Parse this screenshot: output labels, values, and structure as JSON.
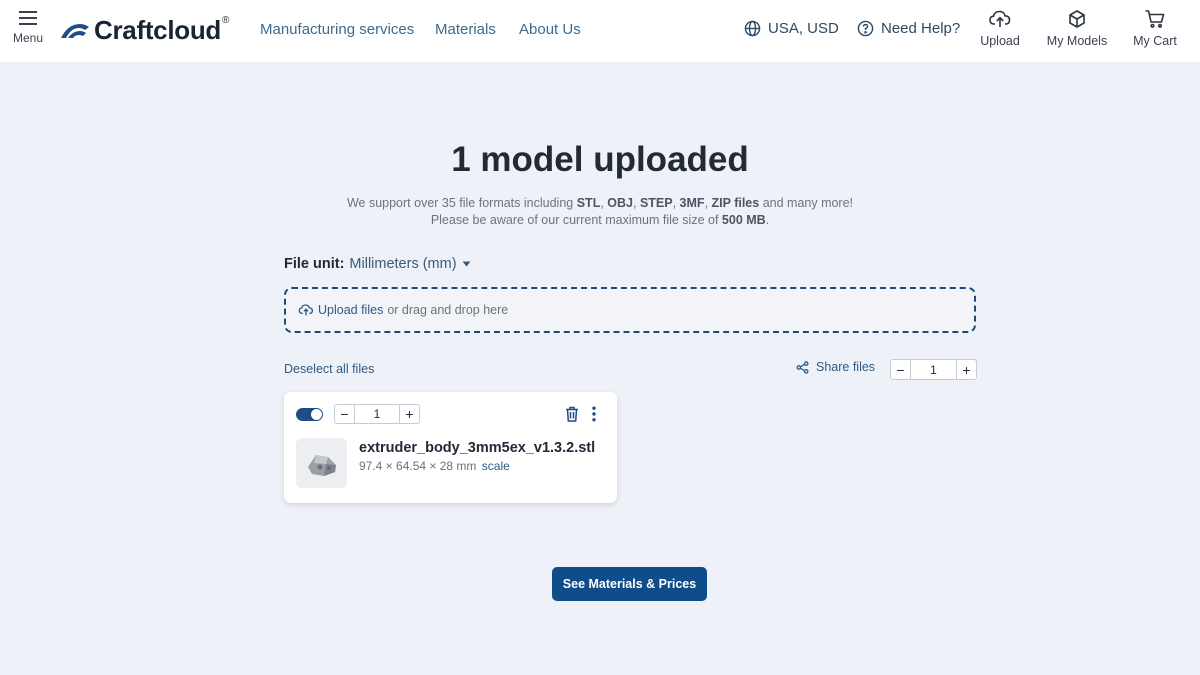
{
  "header": {
    "menu_label": "Menu",
    "brand": "Craftcloud",
    "brand_mark": "®",
    "nav": {
      "manufacturing": "Manufacturing services",
      "materials": "Materials",
      "about": "About Us"
    },
    "region": "USA, USD",
    "help": "Need Help?",
    "upload": "Upload",
    "my_models": "My Models",
    "my_cart": "My Cart"
  },
  "main": {
    "title": "1 model uploaded",
    "support_line1": {
      "pre": "We support over 35 file formats including",
      "f1": "STL",
      "f2": "OBJ",
      "f3": "STEP",
      "f4": "3MF",
      "f5": "ZIP files",
      "post": "and many more!"
    },
    "support_line2": {
      "pre": "Please be aware of our current maximum file size of",
      "size": "500 MB",
      "post": "."
    },
    "file_unit_label": "File unit:",
    "file_unit_value": "Millimeters (mm)",
    "dropzone": {
      "link": "Upload files",
      "text": "or drag and drop here"
    },
    "deselect_all": "Deselect all files",
    "share_files": "Share files",
    "global_quantity": "1",
    "cta": "See Materials & Prices"
  },
  "models": [
    {
      "selected": true,
      "quantity": "1",
      "filename": "extruder_body_3mm5ex_v1.3.2.stl",
      "dimensions": "97.4 × 64.54 × 28 mm",
      "scale_label": "scale"
    }
  ],
  "colors": {
    "accent": "#0f4c8a",
    "link": "#2e5a85",
    "background": "#eef1f7"
  }
}
